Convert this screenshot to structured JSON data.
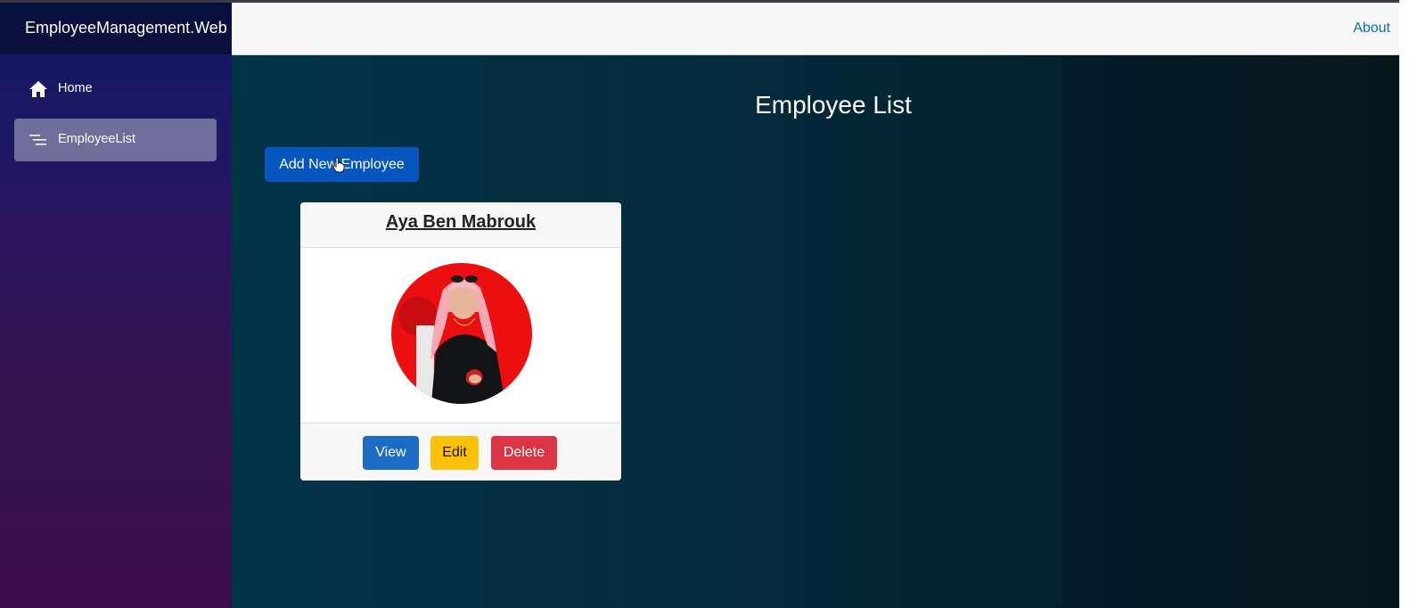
{
  "app": {
    "brand": "EmployeeManagement.Web"
  },
  "sidebar": {
    "items": [
      {
        "label": "Home",
        "icon": "home-icon",
        "active": false
      },
      {
        "label": "EmployeeList",
        "icon": "list-icon",
        "active": true
      }
    ]
  },
  "topbar": {
    "about_label": "About"
  },
  "main": {
    "title": "Employee List",
    "add_button_label": "Add New Employee"
  },
  "employees": [
    {
      "name": "Aya Ben Mabrouk",
      "photo_icon": "employee-photo",
      "actions": {
        "view": "View",
        "edit": "Edit",
        "delete": "Delete"
      }
    }
  ],
  "colors": {
    "primary": "#0756bf",
    "warning": "#fdc10b",
    "danger": "#dc3545",
    "link": "#0071c1"
  }
}
